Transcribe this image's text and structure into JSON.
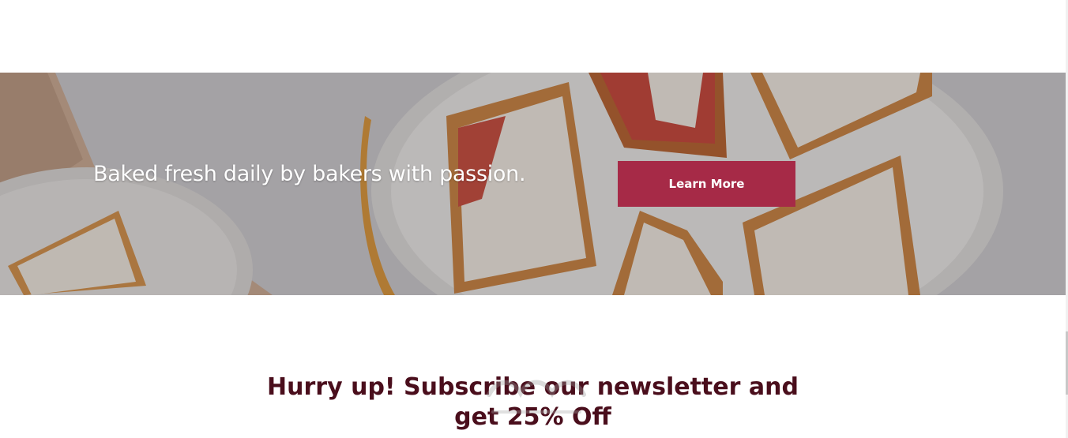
{
  "hero": {
    "tagline": "Baked fresh daily by bakers with passion.",
    "cta_label": "Learn More"
  },
  "newsletter": {
    "title_line1": "Hurry up! Subscribe our newsletter and",
    "title_line2": "get 25% Off"
  },
  "colors": {
    "accent": "#a62a47",
    "heading": "#4a0e1c"
  }
}
